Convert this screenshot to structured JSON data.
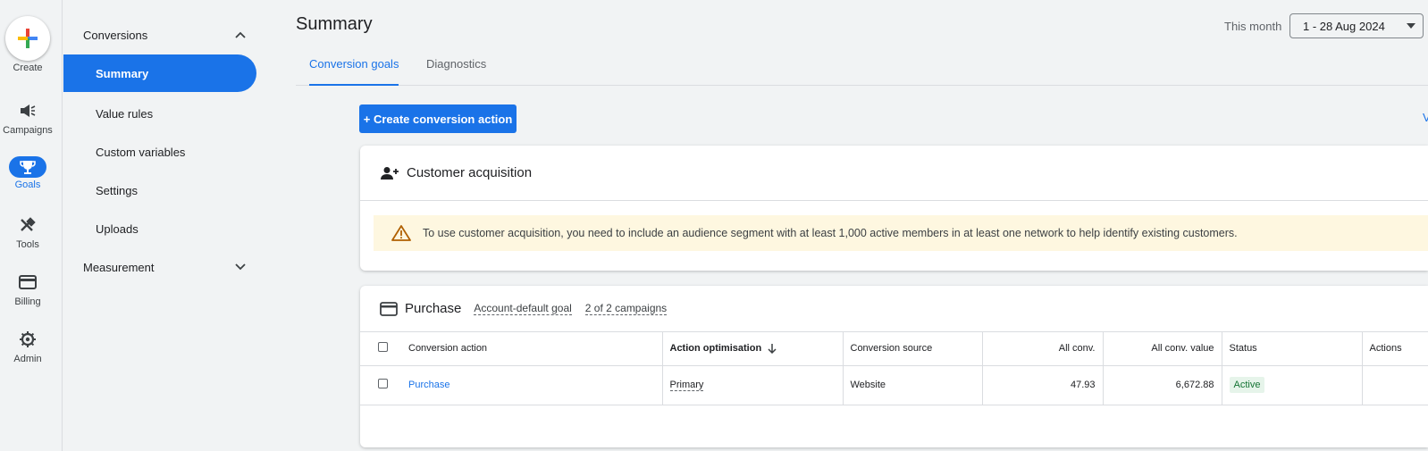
{
  "rail": {
    "create": "Create",
    "items": [
      {
        "label": "Campaigns",
        "icon": "megaphone-icon"
      },
      {
        "label": "Goals",
        "icon": "trophy-icon"
      },
      {
        "label": "Tools",
        "icon": "tools-icon"
      },
      {
        "label": "Billing",
        "icon": "credit-card-icon"
      },
      {
        "label": "Admin",
        "icon": "gear-icon"
      }
    ]
  },
  "subnav": {
    "conversions": "Conversions",
    "items": [
      "Summary",
      "Value rules",
      "Custom variables",
      "Settings",
      "Uploads"
    ],
    "measurement": "Measurement"
  },
  "header": {
    "title": "Summary",
    "date_label": "This month",
    "date_range": "1 - 28 Aug 2024"
  },
  "tabs": [
    "Conversion goals",
    "Diagnostics"
  ],
  "create_button": "+ Create conversion action",
  "right_cut": "V",
  "customer_acquisition": {
    "title": "Customer acquisition",
    "warning": "To use customer acquisition, you need to include an audience segment with at least 1,000 active members in at least one network to help identify existing customers."
  },
  "purchase": {
    "title": "Purchase",
    "default_goal": "Account-default goal",
    "campaigns": "2 of 2 campaigns",
    "columns": [
      "Conversion action",
      "Action optimisation",
      "Conversion source",
      "All conv.",
      "All conv. value",
      "Status",
      "Actions"
    ],
    "rows": [
      {
        "action": "Purchase",
        "optimisation": "Primary",
        "source": "Website",
        "all_conv": "47.93",
        "all_conv_value": "6,672.88",
        "status": "Active"
      }
    ]
  },
  "colors": {
    "accent": "#1a73e8",
    "warning_bg": "#fef7e0",
    "active_badge": "#e6f4ea"
  }
}
